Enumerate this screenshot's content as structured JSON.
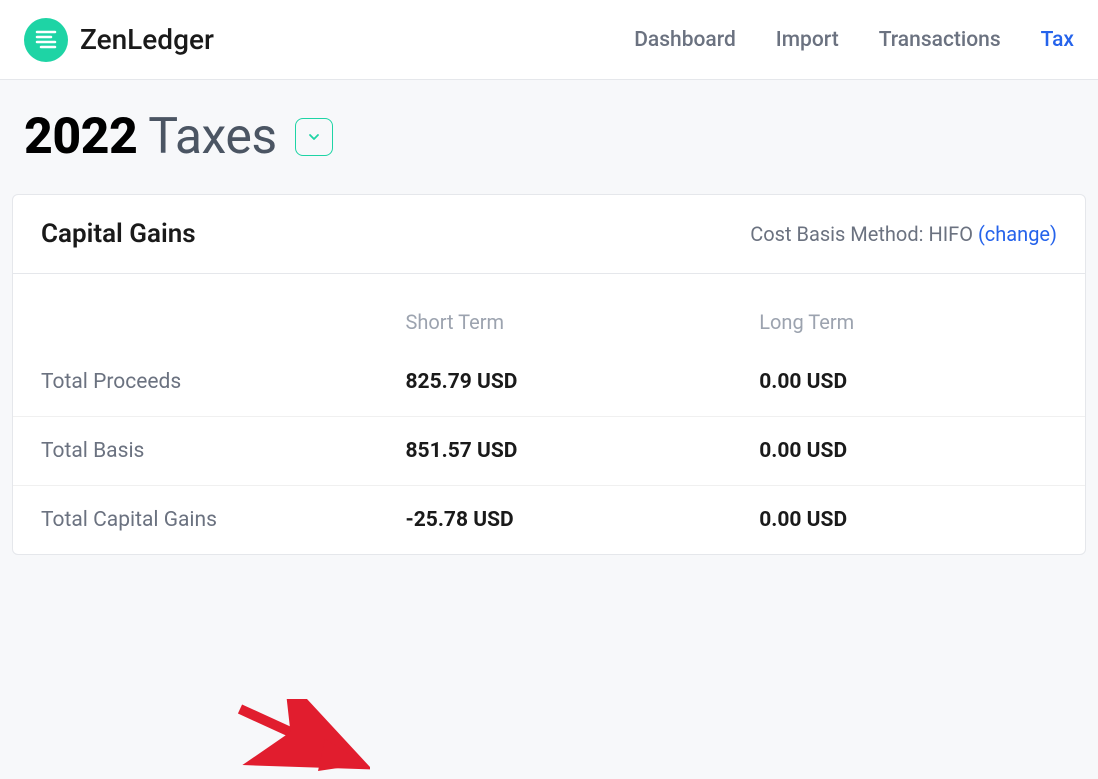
{
  "brand": {
    "name": "ZenLedger"
  },
  "nav": {
    "dashboard": "Dashboard",
    "import": "Import",
    "transactions": "Transactions",
    "tax": "Tax"
  },
  "page": {
    "year": "2022",
    "title_suffix": "Taxes"
  },
  "capital_gains": {
    "title": "Capital Gains",
    "cost_basis_label": "Cost Basis Method: ",
    "cost_basis_method": "HIFO",
    "change_text": "(change)",
    "columns": {
      "short_term": "Short Term",
      "long_term": "Long Term"
    },
    "rows": [
      {
        "label": "Total Proceeds",
        "short": "825.79 USD",
        "long": "0.00 USD"
      },
      {
        "label": "Total Basis",
        "short": "851.57 USD",
        "long": "0.00 USD"
      },
      {
        "label": "Total Capital Gains",
        "short": "-25.78 USD",
        "long": "0.00 USD"
      }
    ]
  }
}
